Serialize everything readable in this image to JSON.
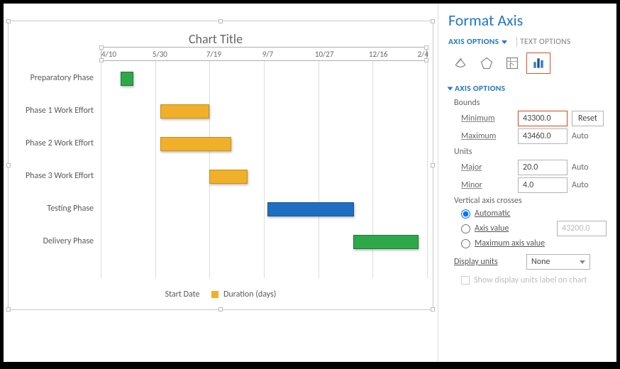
{
  "chart": {
    "title": "Chart Title",
    "categories": [
      "Preparatory Phase",
      "Phase 1 Work Effort",
      "Phase 2 Work Effort",
      "Phase 3 Work Effort",
      "Testing Phase",
      "Delivery Phase"
    ],
    "ticks": [
      "4/10",
      "5/30",
      "7/19",
      "9/7",
      "10/27",
      "12/16",
      "2/4"
    ],
    "legend": {
      "s1": "Start Date",
      "s2": "Duration (days)"
    }
  },
  "chart_data": {
    "type": "bar",
    "orientation": "horizontal",
    "stacked": true,
    "title": "Chart Title",
    "xlabel": "",
    "ylabel": "",
    "x_axis_type": "date-serial",
    "x_ticks_labels": [
      "4/10",
      "5/30",
      "7/19",
      "9/7",
      "10/27",
      "12/16",
      "2/4"
    ],
    "x_ticks_values": [
      43200,
      43250,
      43300,
      43350,
      43400,
      43450,
      43500
    ],
    "xlim": [
      43200,
      43500
    ],
    "categories": [
      "Preparatory Phase",
      "Phase 1 Work Effort",
      "Phase 2 Work Effort",
      "Phase 3 Work Effort",
      "Testing Phase",
      "Delivery Phase"
    ],
    "series": [
      {
        "name": "Start Date",
        "role": "offset-invisible",
        "values": [
          43218,
          43255,
          43255,
          43300,
          43353,
          43432
        ]
      },
      {
        "name": "Duration (days)",
        "role": "visible-bar",
        "values": [
          12,
          45,
          65,
          35,
          80,
          60
        ]
      }
    ],
    "series_colors": {
      "Preparatory Phase": "#2fa84a",
      "Phase 1 Work Effort": "#f0b02a",
      "Phase 2 Work Effort": "#f0b02a",
      "Phase 3 Work Effort": "#f0b02a",
      "Testing Phase": "#1f6fc0",
      "Delivery Phase": "#2fa84a"
    }
  },
  "pane": {
    "title": "Format Axis",
    "tab_axis_options": "AXIS OPTIONS",
    "tab_text_options": "TEXT OPTIONS",
    "section_axis_options": "AXIS OPTIONS",
    "bounds_label": "Bounds",
    "min_label": "Minimum",
    "min_value": "43300.0",
    "min_button": "Reset",
    "max_label": "Maximum",
    "max_value": "43460.0",
    "max_button": "Auto",
    "units_label": "Units",
    "major_label": "Major",
    "major_value": "20.0",
    "major_button": "Auto",
    "minor_label": "Minor",
    "minor_value": "4.0",
    "minor_button": "Auto",
    "vcross_label": "Vertical axis crosses",
    "radio_auto": "Automatic",
    "radio_axis_value": "Axis value",
    "axis_value_input": "43200.0",
    "radio_max": "Maximum axis value",
    "display_units_label": "Display units",
    "display_units_value": "None",
    "show_units_label": "Show display units label on chart"
  }
}
